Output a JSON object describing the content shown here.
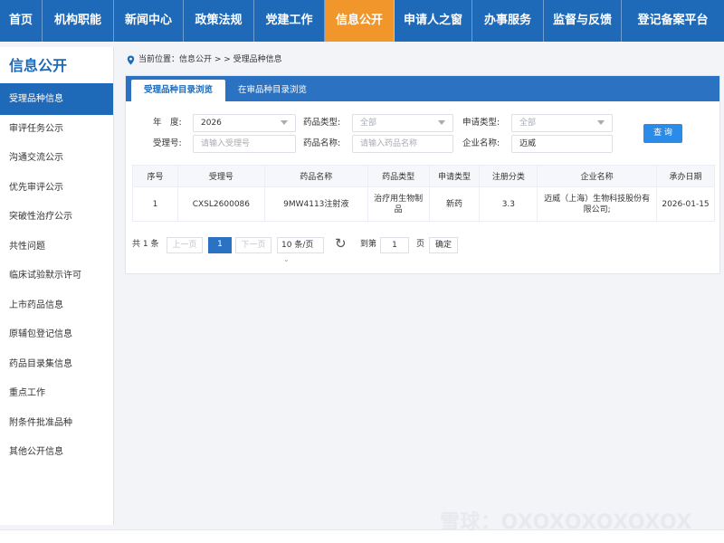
{
  "nav": {
    "items": [
      {
        "label": "首页"
      },
      {
        "label": "机构职能"
      },
      {
        "label": "新闻中心"
      },
      {
        "label": "政策法规"
      },
      {
        "label": "党建工作"
      },
      {
        "label": "信息公开",
        "active": true
      },
      {
        "label": "申请人之窗"
      },
      {
        "label": "办事服务"
      },
      {
        "label": "监督与反馈"
      },
      {
        "label": "登记备案平台"
      }
    ]
  },
  "sidebar": {
    "title": "信息公开",
    "items": [
      {
        "label": "受理品种信息",
        "active": true
      },
      {
        "label": "审评任务公示"
      },
      {
        "label": "沟通交流公示"
      },
      {
        "label": "优先审评公示"
      },
      {
        "label": "突破性治疗公示"
      },
      {
        "label": "共性问题"
      },
      {
        "label": "临床试验默示许可"
      },
      {
        "label": "上市药品信息"
      },
      {
        "label": "原辅包登记信息"
      },
      {
        "label": "药品目录集信息"
      },
      {
        "label": "重点工作"
      },
      {
        "label": "附条件批准品种"
      },
      {
        "label": "其他公开信息"
      }
    ]
  },
  "breadcrumb": {
    "text": "当前位置：信息公开 > > 受理品种信息"
  },
  "tabs": [
    {
      "label": "受理品种目录浏览",
      "active": true
    },
    {
      "label": "在审品种目录浏览"
    }
  ],
  "filters": {
    "year_label": "年　度:",
    "year_value": "2026",
    "drug_type_label": "药品类型:",
    "drug_type_value": "全部",
    "apply_type_label": "申请类型:",
    "apply_type_value": "全部",
    "accept_no_label": "受理号:",
    "accept_no_placeholder": "请输入受理号",
    "drug_name_label": "药品名称:",
    "drug_name_placeholder": "请输入药品名称",
    "company_label": "企业名称:",
    "company_value": "迈威",
    "query_label": "查 询"
  },
  "table": {
    "headers": [
      "序号",
      "受理号",
      "药品名称",
      "药品类型",
      "申请类型",
      "注册分类",
      "企业名称",
      "承办日期"
    ],
    "rows": [
      [
        "1",
        "CXSL2600086",
        "9MW4113注射液",
        "治疗用生物制品",
        "新药",
        "3.3",
        "迈威（上海）生物科技股份有限公司;",
        "2026-01-15"
      ]
    ]
  },
  "pager": {
    "total": "共 1 条",
    "prev": "上一页",
    "current_page": "1",
    "next": "下一页",
    "page_size": "10 条/页",
    "goto_label": "到第",
    "goto_value": "1",
    "page_unit": "页",
    "confirm": "确定"
  },
  "watermark": "雪球：OXOXOXOXOXOX"
}
